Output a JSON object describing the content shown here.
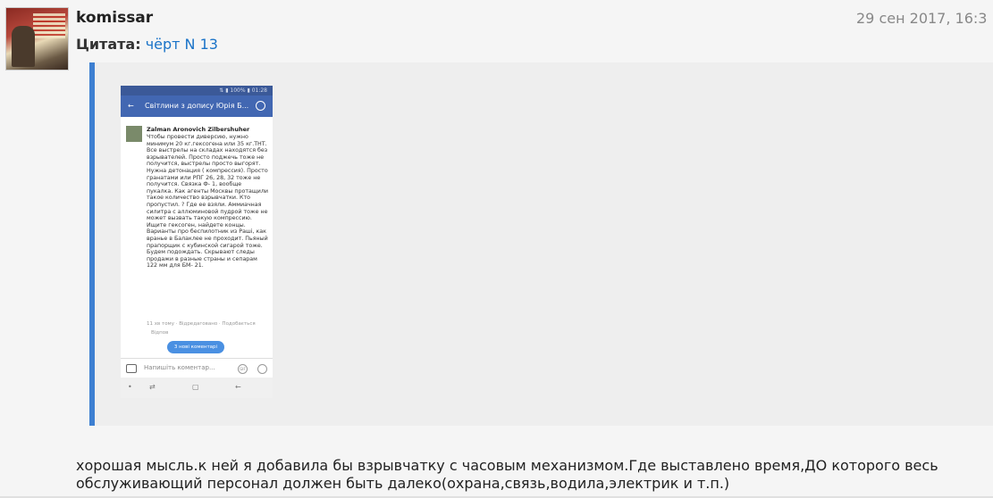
{
  "post": {
    "username": "komissar",
    "date": "29 сен 2017, 16:3",
    "quote_label": "Цитата:",
    "quote_author": "чёрт N 13",
    "message": "хорошая мысль.к ней я добавила бы взрывчатку с часовым механизмом.Где выставлено время,ДО которого весь обслуживающий персонал должен быть далеко(охрана,связь,водила,электрик и т.п.)"
  },
  "phone": {
    "status": "⇅ ▮ 100% ▮ 01:28",
    "title": "Світлини з допису Юрія Б...",
    "author": "Zalman Aronovich Zilbershuher",
    "text": "Чтобы провести диверсию, нужно минимум 20 кг.гексогена или 35 кг.ТНТ. Все выстрелы на складах находятся без взрывателей. Просто поджечь тоже не получится, выстрелы просто выгорят. Нужна детонация ( компрессия). Просто гранатами или РПГ 26, 28, 32 тоже не получится. Связка Ф- 1, вообще пукалка. Как агенты Москвы протащили такое количество взрывчатки. Кто пропустил. ? Где ее взяли. Аммиачная силитра с аллюминовой пудрой тоже не может вызвать такую компрессию. Ищите гексоген, найдете концы. Варианты про беспилотник из Рашi, как вранье в Балаклее не проходит. Пьяный прапорщик с кубинской сигарой тоже. Будем подождать. Скрывают следы продажи в разные страны и сепарам 122 мм для БМ- 21.",
    "meta": "11 хв тому   ·   Відредаговано   ·   Подобається",
    "reply": "Відпов",
    "new_comments": "3 нові коментарі",
    "input_placeholder": "Напишіть коментар...",
    "gif": "GIF"
  }
}
